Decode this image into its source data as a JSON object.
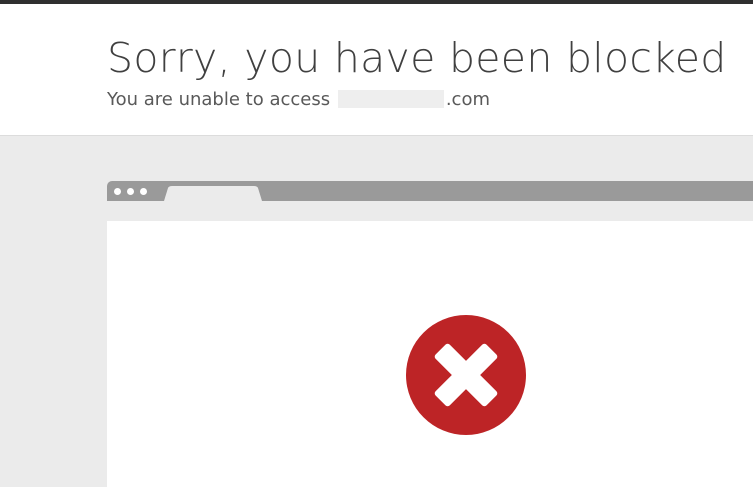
{
  "page": {
    "title": "Sorry, you have been blocked",
    "subtitle_prefix": "You are unable to access",
    "subtitle_domain_suffix": ".com"
  },
  "browser_graphic": {
    "bar_color": "#9a9a9a",
    "window_color": "#ffffff"
  },
  "error_icon": {
    "name": "error-x-icon",
    "color": "#bd2426"
  },
  "colors": {
    "page_background": "#ebebeb",
    "header_background": "#ffffff",
    "title_text": "#404040",
    "subtitle_text": "#595959",
    "top_border": "#2f2f2f"
  }
}
